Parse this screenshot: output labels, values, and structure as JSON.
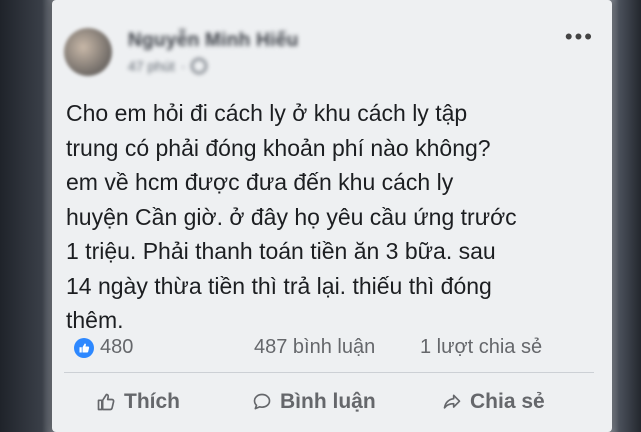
{
  "post": {
    "author": "Nguyễn Minh Hiếu",
    "time": "47 phút",
    "more_label": "•••",
    "text": "Cho em hỏi đi cách ly ở khu cách ly tập\ntrung có phải đóng khoản phí nào không?\nem về hcm được đưa đến khu cách ly\nhuyện Cần giờ. ở đây họ yêu cầu ứng trước\n1 triệu. Phải thanh toán tiền ăn 3 bữa. sau\n14 ngày thừa tiền thì trả lại. thiếu thì đóng\nthêm."
  },
  "stats": {
    "likes": "480",
    "comments": "487 bình luận",
    "shares": "1 lượt chia sẻ"
  },
  "actions": {
    "like": "Thích",
    "comment": "Bình luận",
    "share": "Chia sẻ"
  },
  "icons": {
    "like": "thumbs-up-icon",
    "comment": "comment-icon",
    "share": "share-icon",
    "privacy": "globe-icon",
    "more": "more-options-icon"
  },
  "colors": {
    "like_badge": "#2d88ff",
    "text": "#1c1e21",
    "secondary": "#65676b"
  }
}
